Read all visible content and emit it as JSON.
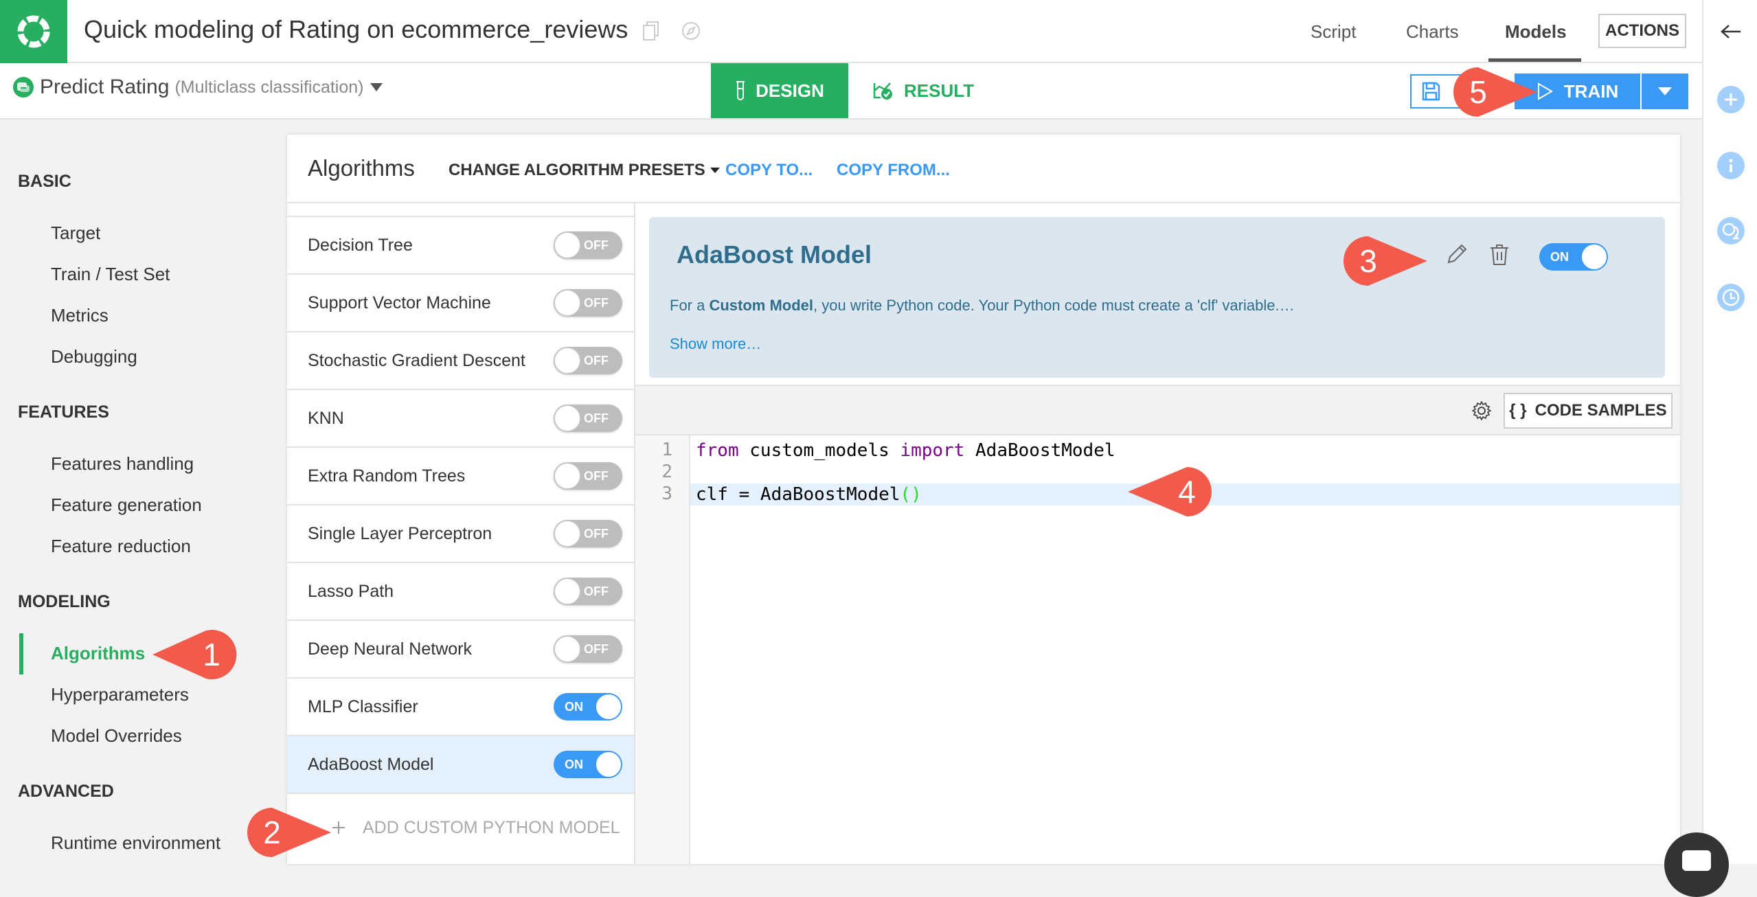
{
  "header": {
    "title": "Quick modeling of Rating on ecommerce_reviews",
    "nav": [
      {
        "label": "Script",
        "active": false
      },
      {
        "label": "Charts",
        "active": false
      },
      {
        "label": "Models",
        "active": true
      }
    ],
    "actions_label": "ACTIONS"
  },
  "subbar": {
    "task_name": "Predict Rating",
    "task_type": "(Multiclass classification)",
    "design_label": "DESIGN",
    "result_label": "RESULT",
    "train_label": "TRAIN"
  },
  "leftnav": {
    "sections": [
      {
        "title": "BASIC",
        "items": [
          "Target",
          "Train / Test Set",
          "Metrics",
          "Debugging"
        ]
      },
      {
        "title": "FEATURES",
        "items": [
          "Features handling",
          "Feature generation",
          "Feature reduction"
        ]
      },
      {
        "title": "MODELING",
        "items": [
          "Algorithms",
          "Hyperparameters",
          "Model Overrides"
        ]
      },
      {
        "title": "ADVANCED",
        "items": [
          "Runtime environment"
        ]
      }
    ],
    "active_item": "Algorithms"
  },
  "card": {
    "title": "Algorithms",
    "presets_label": "CHANGE ALGORITHM PRESETS",
    "copy_to_label": "COPY TO...",
    "copy_from_label": "COPY FROM..."
  },
  "algorithms": [
    {
      "name": "Decision Tree",
      "state": "OFF"
    },
    {
      "name": "Support Vector Machine",
      "state": "OFF"
    },
    {
      "name": "Stochastic Gradient Descent",
      "state": "OFF"
    },
    {
      "name": "KNN",
      "state": "OFF"
    },
    {
      "name": "Extra Random Trees",
      "state": "OFF"
    },
    {
      "name": "Single Layer Perceptron",
      "state": "OFF"
    },
    {
      "name": "Lasso Path",
      "state": "OFF"
    },
    {
      "name": "Deep Neural Network",
      "state": "OFF"
    },
    {
      "name": "MLP Classifier",
      "state": "ON"
    },
    {
      "name": "AdaBoost Model",
      "state": "ON",
      "selected": true
    }
  ],
  "add_custom_label": "ADD CUSTOM PYTHON MODEL",
  "model_detail": {
    "title": "AdaBoost Model",
    "desc_prefix": "For a ",
    "desc_bold": "Custom Model",
    "desc_suffix": ", you write Python code. Your Python code must create a 'clf' variable.…",
    "show_more": "Show more…",
    "state": "ON",
    "code_samples_label": "CODE SAMPLES",
    "code_samples_glyph": "{ }"
  },
  "code": {
    "line_numbers": [
      "1",
      "2",
      "3"
    ],
    "line1": {
      "kw1": "from",
      "mod": " custom_models ",
      "kw2": "import",
      "name": " AdaBoostModel"
    },
    "line3": {
      "text": "clf = AdaBoostModel",
      "paren": "()"
    }
  },
  "callouts": [
    "1",
    "2",
    "3",
    "4",
    "5"
  ],
  "colors": {
    "brand_green": "#27ae60",
    "accent_blue": "#3a99f5",
    "callout_red": "#f25a4c",
    "selected_row": "#e4f0fd",
    "model_box": "#dce6ef"
  }
}
